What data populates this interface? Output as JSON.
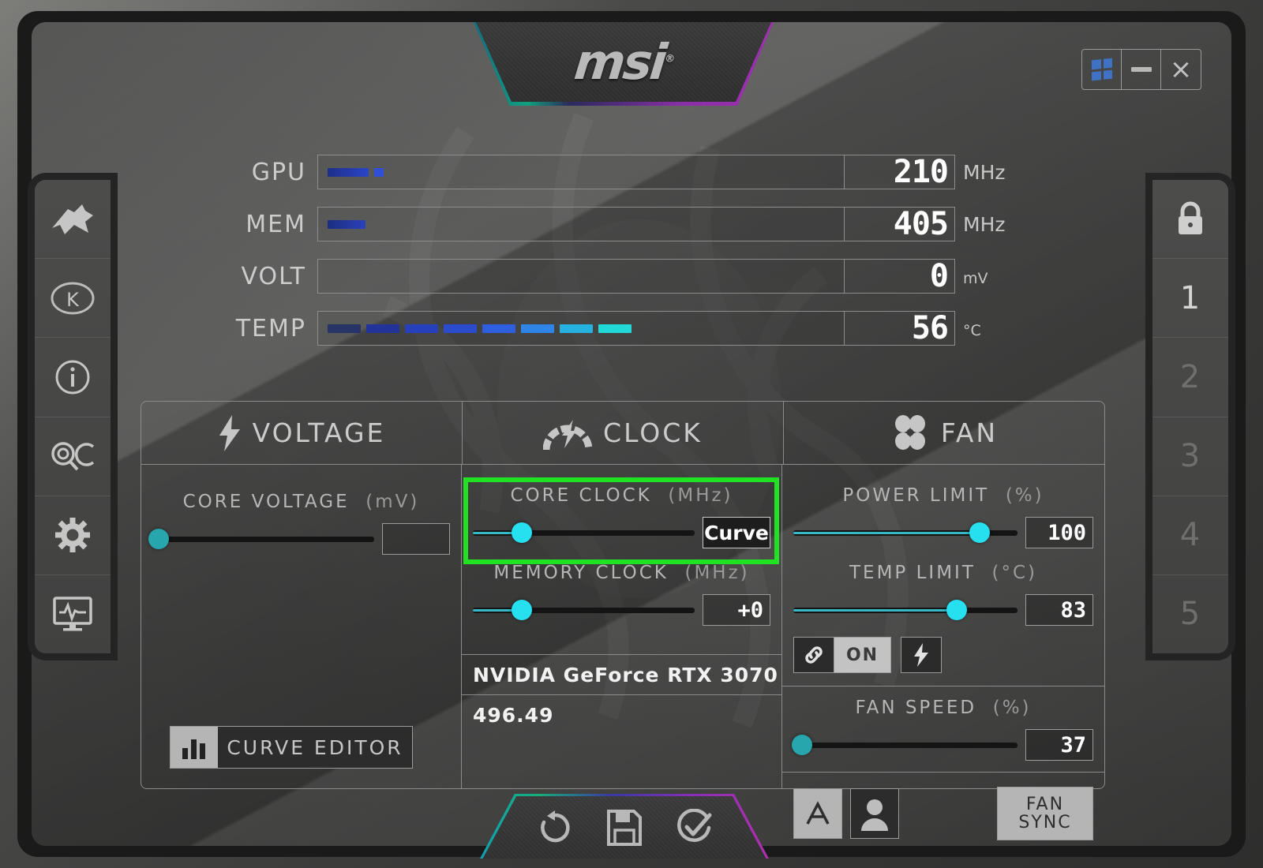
{
  "app": {
    "brand": "msi",
    "brand_sup": "®"
  },
  "window_controls": [
    {
      "name": "windows-logo",
      "label": ""
    },
    {
      "name": "minimize",
      "label": ""
    },
    {
      "name": "close",
      "label": "×"
    }
  ],
  "left_rail": [
    {
      "icon": "jet-fighter-icon",
      "label": ""
    },
    {
      "icon": "k-boost-icon",
      "label": ""
    },
    {
      "icon": "info-icon",
      "label": ""
    },
    {
      "icon": "qc-search-icon",
      "label": ""
    },
    {
      "icon": "gear-icon",
      "label": ""
    },
    {
      "icon": "monitoring-icon",
      "label": ""
    }
  ],
  "right_rail": {
    "lock": {
      "icon": "lock-icon"
    },
    "profiles": [
      {
        "label": "1",
        "active": true
      },
      {
        "label": "2",
        "active": false
      },
      {
        "label": "3",
        "active": false
      },
      {
        "label": "4",
        "active": false
      },
      {
        "label": "5",
        "active": false
      }
    ]
  },
  "readouts": [
    {
      "label": "GPU",
      "value": "210",
      "unit": "MHz",
      "unit_sub": "",
      "segments": 2,
      "bar_kind": "gpu"
    },
    {
      "label": "MEM",
      "value": "405",
      "unit": "MHz",
      "unit_sub": "",
      "segments": 1,
      "bar_kind": "mem"
    },
    {
      "label": "VOLT",
      "value": "0",
      "unit": "mV",
      "unit_sub": "",
      "segments": 0,
      "bar_kind": "volt"
    },
    {
      "label": "TEMP",
      "value": "56",
      "unit": "°C",
      "unit_sub": "",
      "segments": 8,
      "bar_kind": "temp"
    }
  ],
  "tabs": [
    {
      "id": "voltage",
      "label": "VOLTAGE",
      "icon": "lightning-bolt-icon"
    },
    {
      "id": "clock",
      "label": "CLOCK",
      "icon": "speedometer-icon"
    },
    {
      "id": "fan",
      "label": "FAN",
      "icon": "fan-blades-icon"
    }
  ],
  "controls": {
    "core_voltage": {
      "title": "CORE VOLTAGE",
      "unit": "(mV)",
      "value": "",
      "knob_pct": 2,
      "fill_pct": 0,
      "enabled": false
    },
    "core_clock": {
      "title": "CORE CLOCK",
      "unit": "(MHz)",
      "value": "Curve",
      "knob_pct": 22,
      "fill_pct": 22,
      "enabled": true,
      "highlighted": true
    },
    "memory_clock": {
      "title": "MEMORY CLOCK",
      "unit": "(MHz)",
      "value": "+0",
      "knob_pct": 22,
      "fill_pct": 22,
      "enabled": true
    },
    "power_limit": {
      "title": "POWER LIMIT",
      "unit": "(%)",
      "value": "100",
      "knob_pct": 83,
      "fill_pct": 83,
      "enabled": true
    },
    "temp_limit": {
      "title": "TEMP LIMIT",
      "unit": "(°C)",
      "value": "83",
      "knob_pct": 73,
      "fill_pct": 73,
      "enabled": true
    },
    "fan_speed": {
      "title": "FAN SPEED",
      "unit": "(%)",
      "value": "37",
      "knob_pct": 3,
      "fill_pct": 0,
      "enabled": false
    }
  },
  "link_row": {
    "link_icon": "chain-link-icon",
    "on_label": "ON",
    "bolt_icon": "lightning-bolt-icon"
  },
  "gpu_info": {
    "name": "NVIDIA GeForce RTX 3070",
    "driver": "496.49"
  },
  "buttons": {
    "curve_editor": {
      "label": "CURVE EDITOR",
      "icon": "bar-chart-icon"
    },
    "auto_fan": {
      "label": "A",
      "icon": "auto-letter-icon"
    },
    "user_profile": {
      "label": "",
      "icon": "user-icon"
    },
    "fan_sync_line1": "FAN",
    "fan_sync_line2": "SYNC"
  },
  "action_bar": [
    {
      "name": "reset-button",
      "icon": "reset-arrow-icon"
    },
    {
      "name": "save-button",
      "icon": "floppy-disk-icon"
    },
    {
      "name": "apply-button",
      "icon": "check-circle-icon"
    }
  ],
  "colors": {
    "accent_cyan": "#26E0F0",
    "highlight_green": "#22e022",
    "text_light": "#cccccc",
    "value_white": "#ffffff"
  }
}
